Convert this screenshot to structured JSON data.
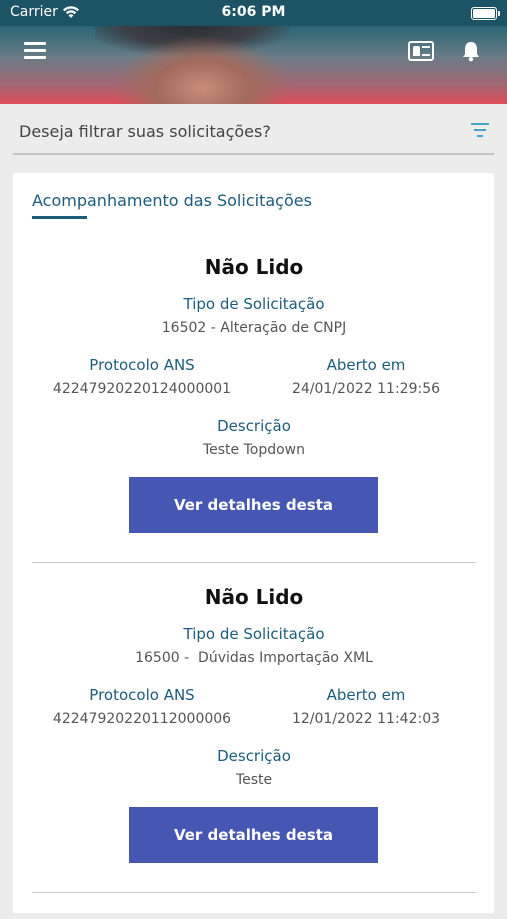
{
  "status_bar": {
    "carrier": "Carrier",
    "time": "6:06 PM"
  },
  "header": {
    "menu_icon": "hamburger-icon",
    "card_icon": "id-card-icon",
    "bell_icon": "bell-icon"
  },
  "filter": {
    "placeholder": "Deseja filtrar suas solicitações?",
    "icon": "filter-icon",
    "accent": "#4aa3c9"
  },
  "section": {
    "title": "Acompanhamento das Solicitações",
    "accent": "#1d5c7a"
  },
  "requests": [
    {
      "status": "Não Lido",
      "type_label": "Tipo de Solicitação",
      "type_value": "16502 - Alteração de CNPJ",
      "protocol_label": "Protocolo ANS",
      "protocol_value": "42247920220124000001",
      "opened_label": "Aberto em",
      "opened_value": "24/01/2022 11:29:56",
      "description_label": "Descrição",
      "description_value": "Teste Topdown",
      "button_label": "Ver detalhes desta solicitação"
    },
    {
      "status": "Não Lido",
      "type_label": "Tipo de Solicitação",
      "type_value": "16500 -  Dúvidas Importação XML",
      "protocol_label": "Protocolo ANS",
      "protocol_value": "42247920220112000006",
      "opened_label": "Aberto em",
      "opened_value": "12/01/2022 11:42:03",
      "description_label": "Descrição",
      "description_value": "Teste",
      "button_label": "Ver detalhes desta solicitação"
    }
  ],
  "colors": {
    "status_bar": "#1d5465",
    "button": "#4657b3"
  }
}
